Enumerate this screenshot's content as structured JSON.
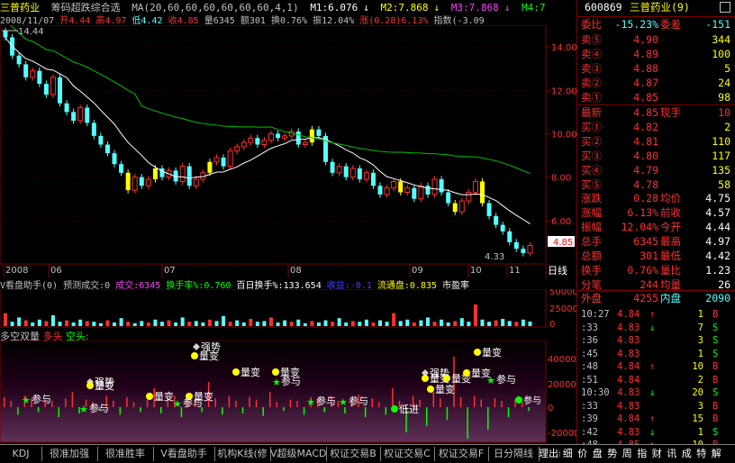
{
  "title": {
    "name": "三普药业",
    "indicator": "筹码超跌综合选",
    "ma": "MA(20,60,60,60,60,60,60,4,1)",
    "m1": "M1:6.076",
    "m2": "M2:7.868",
    "m3": "M3:7.868",
    "m4": "M4:7.868",
    "arrow": "↓"
  },
  "info": {
    "date": "2008/11/07",
    "open": "开4.44",
    "high": "高4.97",
    "low": "低4.42",
    "close": "收4.85",
    "volume": "量6345",
    "amount": "额301",
    "turnover": "换0.76%",
    "amplitude": "振12.04%",
    "change": "涨(0.28)6.13%",
    "index": "指数(-3.09"
  },
  "kline": {
    "ymax_label": "14.44",
    "ymin_label": "4.33",
    "y_ticks": [
      "14.00",
      "12.00",
      "10.00",
      "8.00",
      "6.00"
    ],
    "current_price_tag": "4.85",
    "months": [
      "2008",
      "06",
      "07",
      "08",
      "09",
      "10",
      "11"
    ],
    "period": "日线",
    "chart_data": {
      "type": "candlestick",
      "ylim": [
        4.0,
        15.0
      ],
      "values": [
        14.44,
        13.6,
        13.2,
        12.6,
        12.9,
        12.3,
        11.8,
        12.6,
        11.4,
        11.0,
        10.6,
        11.2,
        10.5,
        9.9,
        9.5,
        9.1,
        8.6,
        8.2,
        7.4,
        8.0,
        7.6,
        7.9,
        8.4,
        8.0,
        8.3,
        7.8,
        8.5,
        7.6,
        7.9,
        8.2,
        8.7,
        8.9,
        8.5,
        9.2,
        9.4,
        9.6,
        9.8,
        9.5,
        9.7,
        10.0,
        9.8,
        9.9,
        10.1,
        9.5,
        9.6,
        10.2,
        9.9,
        8.7,
        8.2,
        8.5,
        8.0,
        8.4,
        7.9,
        8.2,
        7.6,
        7.2,
        7.5,
        7.8,
        7.3,
        7.5,
        7.0,
        7.6,
        7.2,
        7.9,
        7.3,
        6.8,
        6.4,
        6.9,
        7.3,
        7.8,
        6.8,
        6.2,
        5.8,
        5.5,
        5.0,
        4.7,
        4.5,
        4.85
      ]
    }
  },
  "volume": {
    "header": {
      "title": "V看盘助手(0)",
      "predict": "预测成交:0",
      "vol": "成交:6345",
      "turnover": "换手率%:0.760",
      "hundred": "百日换手%:133.654",
      "gain": "收益:-0.1",
      "float": "流通盘:0.835",
      "pe": "市盈率"
    },
    "y_ticks": [
      "50000",
      "25000",
      "0"
    ],
    "chart_data": {
      "type": "bar",
      "values": [
        18000,
        6000,
        12000,
        8000,
        5000,
        9000,
        7000,
        15000,
        6000,
        8000,
        5000,
        9000,
        7000,
        6000,
        4000,
        8000,
        5000,
        11000,
        6000,
        4000,
        7000,
        5000,
        9000,
        6000,
        8000,
        5000,
        12000,
        6000,
        7000,
        5000,
        9000,
        7000,
        14000,
        6000,
        8000,
        5000,
        10000,
        6000,
        7000,
        12000,
        5000,
        8000,
        6000,
        9000,
        4000,
        7000,
        5000,
        8000,
        6000,
        11000,
        5000,
        7000,
        6000,
        9000,
        5000,
        8000,
        6000,
        18000,
        7000,
        9000,
        5000,
        8000,
        12000,
        6000,
        9000,
        5000,
        7000,
        11000,
        6000,
        30000,
        9000,
        6000,
        8000,
        10000,
        7000,
        6000,
        9000,
        6345
      ]
    }
  },
  "duokong": {
    "title": "多空双量",
    "duo": "多头",
    "kong": "空头:",
    "y_ticks": [
      "40000",
      "20000",
      "0",
      "-20000"
    ],
    "labels": {
      "qiangshi": "强势",
      "liangbian": "量变",
      "canyu": "参与",
      "dijin": "低进"
    },
    "chart_data": {
      "type": "bar",
      "values": [
        8000,
        5000,
        -6000,
        9000,
        7000,
        -4000,
        6000,
        5000,
        -8000,
        7000,
        12000,
        -5000,
        6000,
        4000,
        -3000,
        9000,
        5000,
        -6000,
        8000,
        4000,
        -4000,
        6000,
        15000,
        -5000,
        7000,
        9000,
        -8000,
        5000,
        6000,
        -4000,
        20000,
        7000,
        -6000,
        9000,
        5000,
        -5000,
        8000,
        6000,
        -7000,
        12000,
        4000,
        -3000,
        6000,
        5000,
        -6000,
        8000,
        7000,
        -4000,
        9000,
        5000,
        -5000,
        6000,
        10000,
        -8000,
        7000,
        4000,
        -6000,
        15000,
        5000,
        -20000,
        9000,
        6000,
        -15000,
        12000,
        7000,
        -10000,
        40000,
        8000,
        -25000,
        9000,
        6000,
        -18000,
        7000,
        5000,
        -8000,
        6000,
        4000,
        -3000
      ]
    }
  },
  "quote": {
    "code": "600869",
    "name": "三普药业(9)",
    "weibi_label": "委比",
    "weibi": "-15.23%",
    "weicha_label": "委差",
    "weicha": "-151",
    "sell": [
      {
        "label": "卖⑤",
        "price": "4.90",
        "vol": "344"
      },
      {
        "label": "卖④",
        "price": "4.89",
        "vol": "100"
      },
      {
        "label": "卖③",
        "price": "4.88",
        "vol": "5"
      },
      {
        "label": "卖②",
        "price": "4.87",
        "vol": "24"
      },
      {
        "label": "卖①",
        "price": "4.85",
        "vol": "98"
      }
    ],
    "latest_label": "最新",
    "latest": "4.85",
    "now_label": "现手",
    "now": "10",
    "buy": [
      {
        "label": "买①",
        "price": "4.82",
        "vol": "2"
      },
      {
        "label": "买②",
        "price": "4.81",
        "vol": "110"
      },
      {
        "label": "买③",
        "price": "4.80",
        "vol": "117"
      },
      {
        "label": "买④",
        "price": "4.79",
        "vol": "135"
      },
      {
        "label": "买⑤",
        "price": "4.78",
        "vol": "58"
      }
    ],
    "stats": [
      {
        "l1": "涨跌",
        "v1": "0.28",
        "l2": "均价",
        "v2": "4.75"
      },
      {
        "l1": "涨幅",
        "v1": "6.13%",
        "l2": "前收",
        "v2": "4.57"
      },
      {
        "l1": "振幅",
        "v1": "12.04%",
        "l2": "今开",
        "v2": "4.44"
      },
      {
        "l1": "总手",
        "v1": "6345",
        "l2": "最高",
        "v2": "4.97"
      },
      {
        "l1": "总额",
        "v1": "301",
        "l2": "最低",
        "v2": "4.42"
      },
      {
        "l1": "换手",
        "v1": "0.76%",
        "l2": "量比",
        "v2": "1.23"
      },
      {
        "l1": "分笔",
        "v1": "244",
        "l2": "均量",
        "v2": "26"
      }
    ],
    "waipan_label": "外盘",
    "waipan": "4255",
    "neipan_label": "内盘",
    "neipan": "2090",
    "ticks": [
      {
        "time": "10:27",
        "price": "4.84",
        "arrow": "↑",
        "vol": "1",
        "bs": "B"
      },
      {
        "time": ":33",
        "price": "4.83",
        "arrow": "↓",
        "vol": "7",
        "bs": "S"
      },
      {
        "time": ":36",
        "price": "4.83",
        "arrow": "",
        "vol": "3",
        "bs": "S"
      },
      {
        "time": ":45",
        "price": "4.83",
        "arrow": "",
        "vol": "1",
        "bs": "S"
      },
      {
        "time": ":48",
        "price": "4.84",
        "arrow": "↑",
        "vol": "10",
        "bs": "B"
      },
      {
        "time": ":51",
        "price": "4.84",
        "arrow": "",
        "vol": "2",
        "bs": "B"
      },
      {
        "time": "10:30",
        "price": "4.83",
        "arrow": "↓",
        "vol": "20",
        "bs": "S"
      },
      {
        "time": ":33",
        "price": "4.83",
        "arrow": "",
        "vol": "3",
        "bs": "B"
      },
      {
        "time": ":39",
        "price": "4.84",
        "arrow": "↑",
        "vol": "15",
        "bs": "B"
      },
      {
        "time": ":42",
        "price": "4.83",
        "arrow": "↓",
        "vol": "1",
        "bs": "S"
      },
      {
        "time": ":48",
        "price": "4.85",
        "arrow": "↑",
        "vol": "10",
        "bs": "B"
      }
    ]
  },
  "tabs": [
    "KDJ",
    "很准加强",
    "很准胜率",
    "V看盘助手",
    "机构K线(修",
    "V超级MACD",
    "权证交易B",
    "权证交易C",
    "权证交易F",
    "日分隔线",
    "理出击",
    "细",
    "价",
    "盘",
    "势",
    "周",
    "指",
    "财",
    "讯",
    "成",
    "特",
    "解"
  ],
  "colors": {
    "up": "#ff3030",
    "down": "#54ffff",
    "yellow": "#ffff00",
    "white": "#ffffff",
    "green": "#00ff00",
    "border": "#800000"
  }
}
